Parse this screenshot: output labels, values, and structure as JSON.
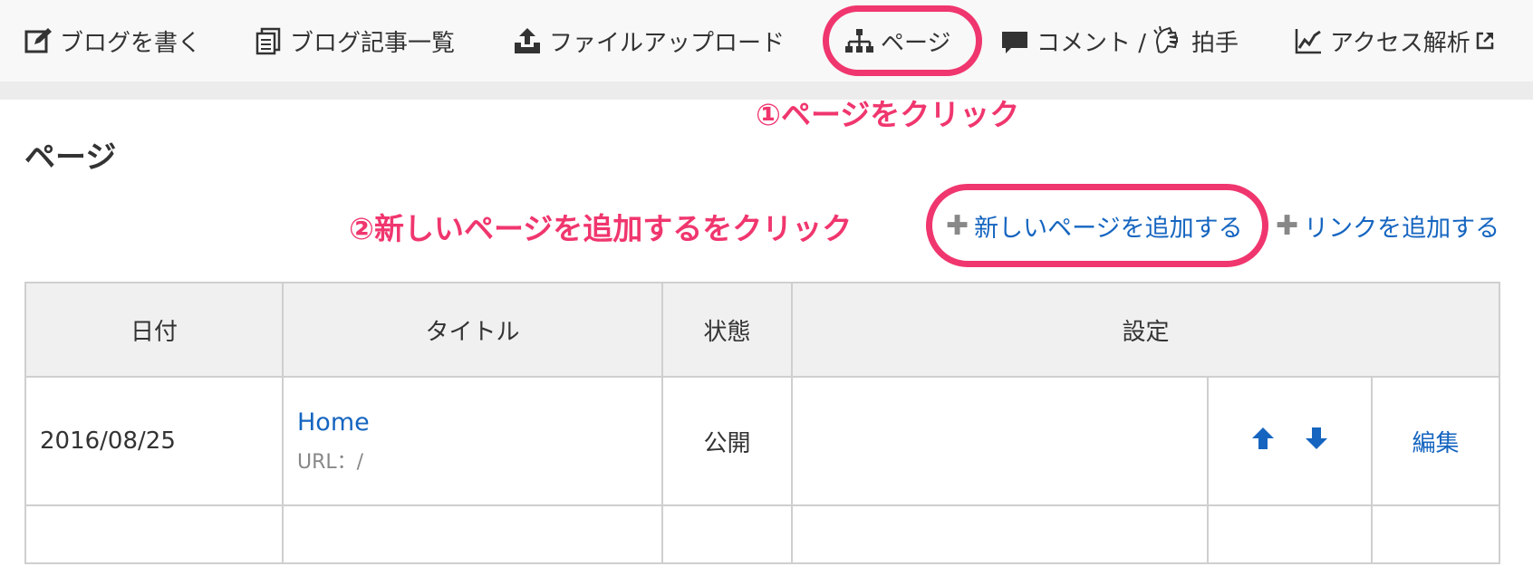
{
  "nav": {
    "write": "ブログを書く",
    "list": "ブログ記事一覧",
    "upload": "ファイルアップロード",
    "page": "ページ",
    "comment": "コメント /",
    "applause": "拍手",
    "analytics": "アクセス解析"
  },
  "page_title": "ページ",
  "actions": {
    "add_page": "新しいページを追加する",
    "add_link": "リンクを追加する"
  },
  "annotations": {
    "step1": "①ページをクリック",
    "step2": "②新しいページを追加するをクリック"
  },
  "table": {
    "headers": [
      "日付",
      "タイトル",
      "状態",
      "設定"
    ],
    "rows": [
      {
        "date": "2016/08/25",
        "title": "Home",
        "url": "URL：/",
        "status": "公開",
        "edit": "編集"
      }
    ]
  },
  "colors": {
    "accent": "#f0366e",
    "link": "#1565c0",
    "arrow": "#1565c0"
  }
}
